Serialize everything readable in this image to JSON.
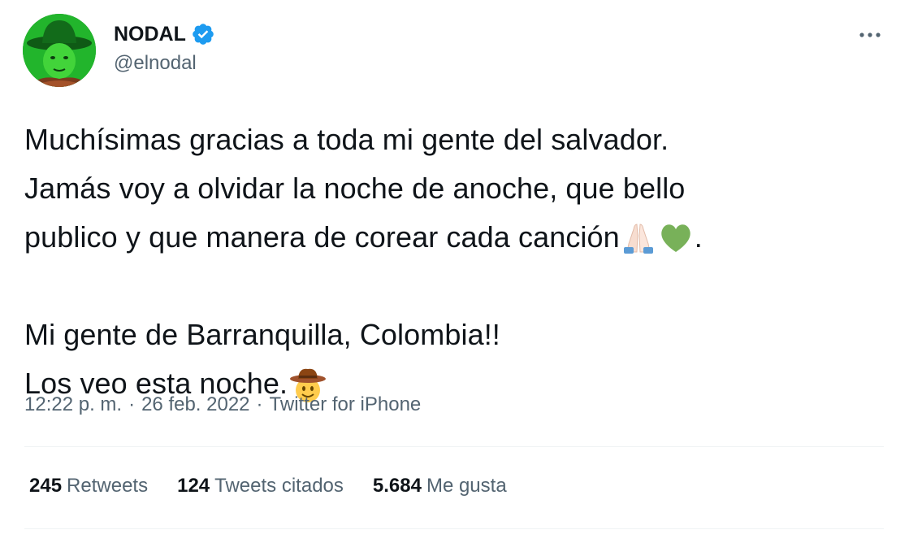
{
  "author": {
    "display_name": "NODAL",
    "handle": "@elnodal",
    "verified": true,
    "verified_color": "#1d9bf0",
    "avatar_icon": "profile-photo-cowboy-hat"
  },
  "tweet": {
    "lines": [
      "Muchísimas gracias a toda mi gente del salvador.",
      "Jamás voy a olvidar la noche de anoche, que bello",
      "publico y que manera de corear cada canción",
      "",
      "Mi gente de Barranquilla, Colombia!!",
      "Los veo esta noche."
    ],
    "line3_end": ".",
    "emojis": {
      "praying_hands": "folded-hands-emoji",
      "green_heart": "green-heart-emoji",
      "cowboy": "cowboy-hat-face-emoji"
    }
  },
  "meta": {
    "time": "12:22 p. m.",
    "separator": "·",
    "date": "26 feb. 2022",
    "source": "Twitter for iPhone"
  },
  "stats": {
    "retweets_count": "245",
    "retweets_label": "Retweets",
    "quotes_count": "124",
    "quotes_label": "Tweets citados",
    "likes_count": "5.684",
    "likes_label": "Me gusta"
  },
  "colors": {
    "text": "#0f1419",
    "secondary": "#536471",
    "divider": "#eff3f4"
  }
}
